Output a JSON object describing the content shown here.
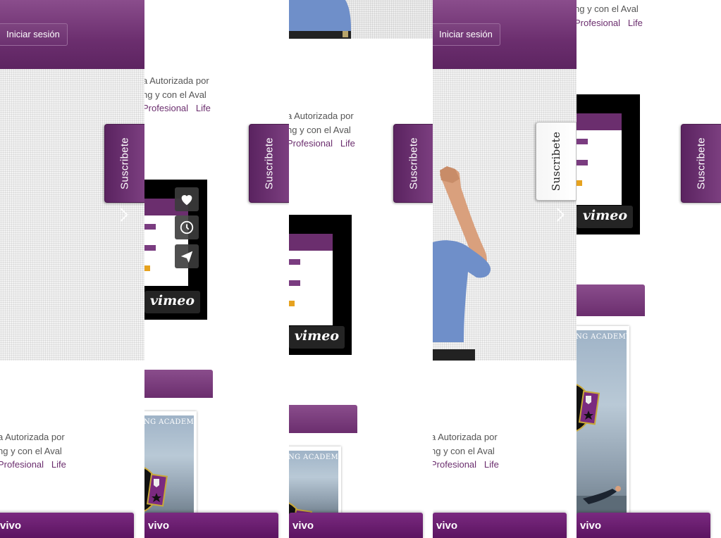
{
  "header": {
    "login_label": "Iniciar sesión"
  },
  "subscribe": {
    "label": "Suscribete"
  },
  "intro": {
    "line1": "a Autorizada por",
    "line2": "ng y con el Aval",
    "link_profesional": "Profesional",
    "link_life": "Life"
  },
  "live_bar": {
    "label": "vivo"
  },
  "academy": {
    "banner_text": "NG ACADEMY"
  },
  "video": {
    "provider": "vimeo"
  },
  "colors": {
    "brand_purple": "#6b2e6e",
    "live_purple": "#5a125f"
  }
}
